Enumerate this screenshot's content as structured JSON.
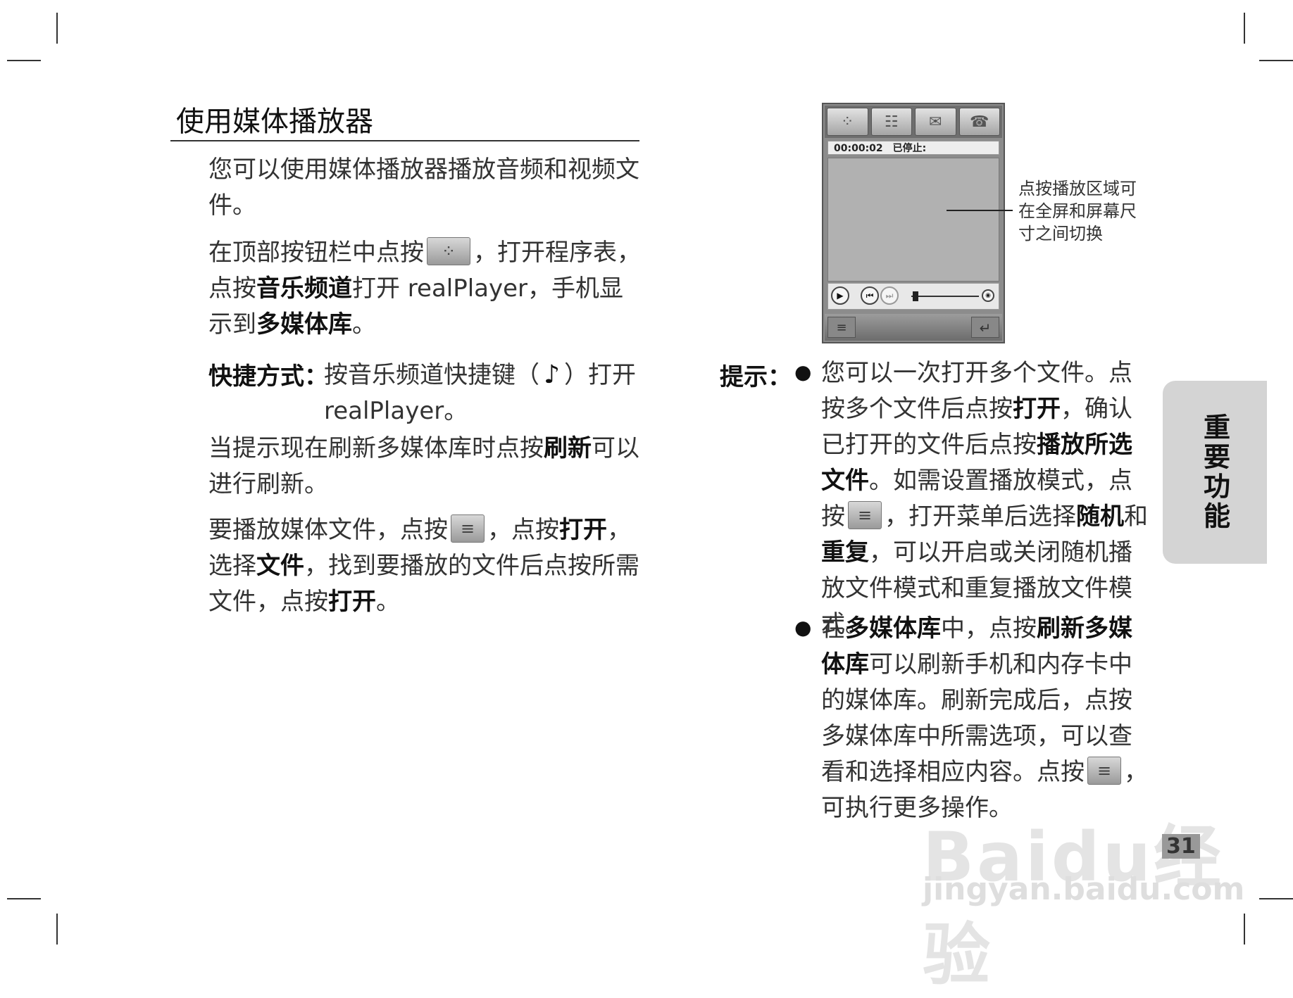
{
  "section": {
    "title": "使用媒体播放器"
  },
  "left": {
    "p1": "您可以使用媒体播放器播放音频和视频文件。",
    "p2_a": "在顶部按钮栏中点按",
    "p2_b": "，打开程序表，点按",
    "p2_bold1": "音乐频道",
    "p2_c": "打开 realPlayer，手机显示到",
    "p2_bold2": "多媒体库",
    "p2_d": "。",
    "shortcut_label": "快捷方式：",
    "shortcut_a": "按音乐频道快捷键（",
    "shortcut_b": "）打开 realPlayer。",
    "p3_a": "当提示现在刷新多媒体库时点按",
    "p3_bold": "刷新",
    "p3_b": "可以进行刷新。",
    "p4_a": "要播放媒体文件，点按",
    "p4_b": "，点按",
    "p4_bold1": "打开",
    "p4_c": "，选择",
    "p4_bold2": "文件",
    "p4_d": "，找到要播放的文件后点按所需文件，点按",
    "p4_bold3": "打开",
    "p4_e": "。"
  },
  "phone": {
    "time": "00:00:02",
    "state": "已停止:"
  },
  "callout": "点按播放区域可在全屏和屏幕尺寸之间切换",
  "tips": {
    "label": "提示：",
    "t1_a": "您可以一次打开多个文件。点按多个文件后点按",
    "t1_bold1": "打开",
    "t1_b": "，确认已打开的文件后点按",
    "t1_bold2": "播放所选文件",
    "t1_c": "。如需设置播放模式，点按",
    "t1_d": "，打开菜单后选择",
    "t1_bold3": "随机",
    "t1_e": "和",
    "t1_bold4": "重复",
    "t1_f": "，可以开启或关闭随机播放文件模式和重复播放文件模式。",
    "t2_a": "在",
    "t2_bold1": "多媒体库",
    "t2_b": "中，点按",
    "t2_bold2": "刷新多媒体库",
    "t2_c": "可以刷新手机和内存卡中的媒体库。刷新完成后，点按多媒体库中所需选项，可以查看和选择相应内容。点按",
    "t2_d": "，可执行更多操作。"
  },
  "side_tab": "重要功能",
  "page_number": "31",
  "watermark": {
    "brand": "Baidu经验",
    "url": "jingyan.baidu.com"
  },
  "icons": [
    "apps-grid-icon",
    "music-channel-icon",
    "menu-icon",
    "play-icon",
    "previous-icon",
    "next-icon",
    "volume-icon",
    "back-icon"
  ]
}
